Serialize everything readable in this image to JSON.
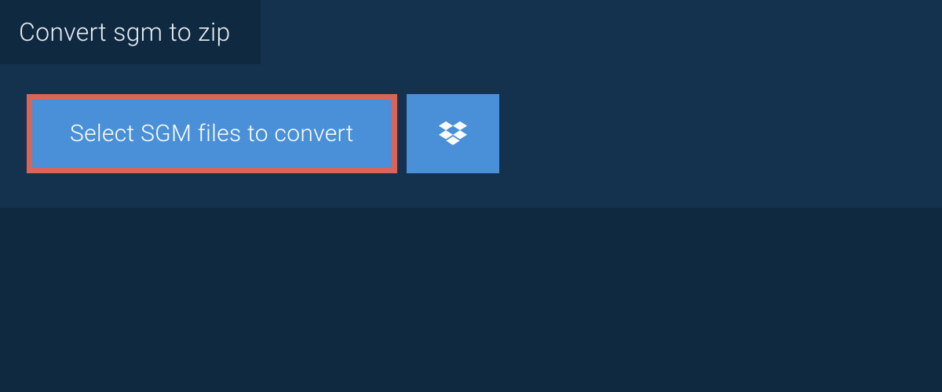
{
  "tab": {
    "title": "Convert sgm to zip"
  },
  "actions": {
    "select_label": "Select SGM files to convert",
    "dropbox_icon_name": "dropbox-icon"
  },
  "colors": {
    "page_bg": "#0f2940",
    "panel_bg": "#14324d",
    "button_bg": "#4a90d9",
    "highlight_border": "#d96459",
    "text_light": "#ffffff",
    "tab_text": "#e8eef4"
  }
}
